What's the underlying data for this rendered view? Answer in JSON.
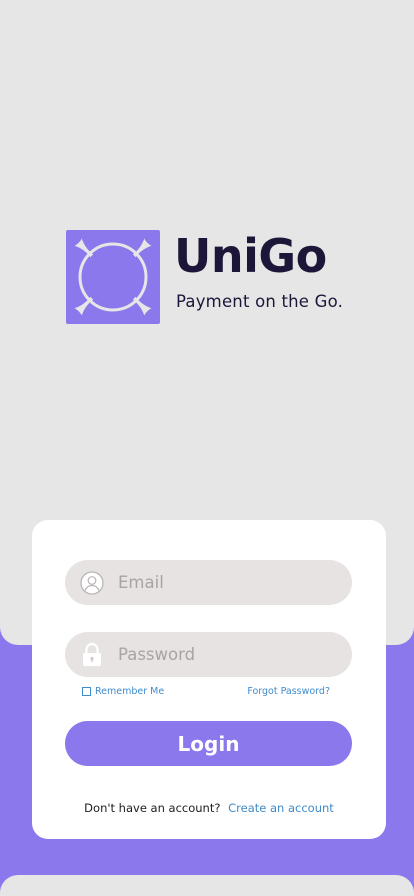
{
  "brand": {
    "name": "UniGo",
    "tagline": "Payment on the Go.",
    "logo_icon": "unigo-logo-mark",
    "color_dark": "#1d1639",
    "color_accent": "#8a78ec"
  },
  "form": {
    "email": {
      "placeholder": "Email",
      "value": "",
      "icon": "user-icon"
    },
    "password": {
      "placeholder": "Password",
      "value": "",
      "icon": "lock-icon"
    },
    "remember_label": "Remember Me",
    "remember_checked": false,
    "forgot_label": "Forgot Password?",
    "login_label": "Login"
  },
  "signup": {
    "prompt": "Don't have an account?",
    "link": "Create an account"
  },
  "colors": {
    "background": "#e6e6e6",
    "accent": "#8a78ec",
    "field_bg": "#e7e3e3",
    "link": "#3f8ccc"
  }
}
